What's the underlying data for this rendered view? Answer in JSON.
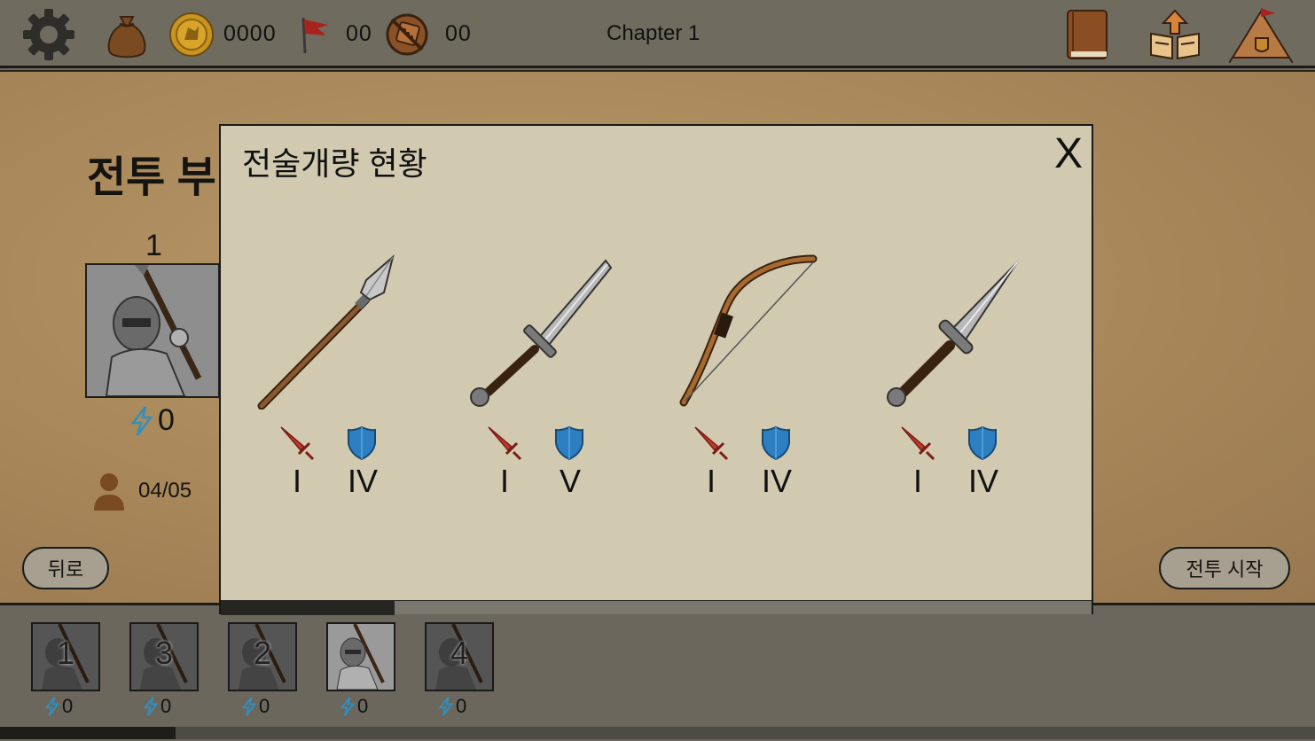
{
  "topbar": {
    "gold": "0000",
    "flags": "00",
    "dice": "00",
    "chapter": "Chapter 1",
    "icons": [
      "gear-icon",
      "money-bag-icon",
      "coin-icon",
      "flag-icon",
      "dice-icon",
      "book-icon",
      "upgrade-book-icon",
      "camp-tent-icon"
    ]
  },
  "party": {
    "title_partial": "전투 부",
    "selected_unit": "1",
    "energy": "0",
    "unit_count": "04/05",
    "back_button": "뒤로",
    "start_button": "전투 시작"
  },
  "roster": [
    {
      "num": "1",
      "energy": "0",
      "active": false
    },
    {
      "num": "3",
      "energy": "0",
      "active": false
    },
    {
      "num": "2",
      "energy": "0",
      "active": false
    },
    {
      "num": "",
      "energy": "0",
      "active": true
    },
    {
      "num": "4",
      "energy": "0",
      "active": false
    }
  ],
  "modal": {
    "title": "전술개량 현황",
    "close": "X",
    "weapons": [
      {
        "name": "spear",
        "attack": "I",
        "defense": "IV"
      },
      {
        "name": "sword",
        "attack": "I",
        "defense": "V"
      },
      {
        "name": "bow",
        "attack": "I",
        "defense": "IV"
      },
      {
        "name": "dagger",
        "attack": "I",
        "defense": "IV"
      }
    ]
  },
  "colors": {
    "parchment": "#a8875a",
    "modal_bg": "#d1c9b0",
    "topbar": "#6f6b5f",
    "attack_red": "#c0392b",
    "shield_blue": "#2d7fc1",
    "energy_blue": "#2f8fbf"
  }
}
